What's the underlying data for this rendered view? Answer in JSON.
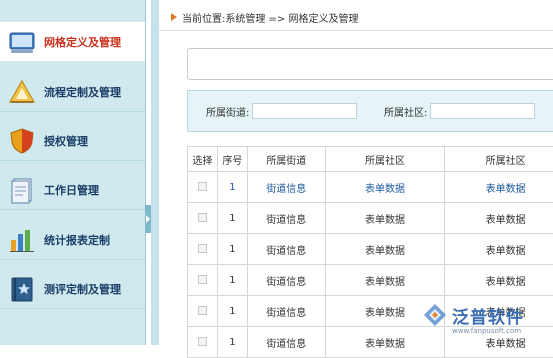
{
  "sidebar": {
    "items": [
      {
        "label": "网格定义及管理",
        "icon": "monitor-icon",
        "active": true
      },
      {
        "label": "流程定制及管理",
        "icon": "triangle-ruler-icon",
        "active": false
      },
      {
        "label": "授权管理",
        "icon": "shield-icon",
        "active": false
      },
      {
        "label": "工作日管理",
        "icon": "document-icon",
        "active": false
      },
      {
        "label": "统计报表定制",
        "icon": "bar-chart-icon",
        "active": false
      },
      {
        "label": "测评定制及管理",
        "icon": "star-book-icon",
        "active": false
      }
    ]
  },
  "breadcrumb": {
    "text": "当前位置:系统管理 => 网格定义及管理"
  },
  "filters": {
    "street_label": "所属街道:",
    "community_label": "所属社区:"
  },
  "table": {
    "headers": [
      "选择",
      "序号",
      "所属街道",
      "所属社区",
      "所属社区"
    ],
    "rows": [
      {
        "index": "1",
        "street": "街道信息",
        "community": "表单数据",
        "community2": "表单数据",
        "link": true
      },
      {
        "index": "1",
        "street": "街道信息",
        "community": "表单数据",
        "community2": "表单数据",
        "link": false
      },
      {
        "index": "1",
        "street": "街道信息",
        "community": "表单数据",
        "community2": "表单数据",
        "link": false
      },
      {
        "index": "1",
        "street": "街道信息",
        "community": "表单数据",
        "community2": "表单数据",
        "link": false
      },
      {
        "index": "1",
        "street": "街道信息",
        "community": "表单数据",
        "community2": "表单数据",
        "link": false
      },
      {
        "index": "1",
        "street": "街道信息",
        "community": "表单数据",
        "community2": "表单数据",
        "link": false
      }
    ]
  },
  "watermark": {
    "text": "泛普软件",
    "url": "www.fanpusoft.com"
  },
  "colors": {
    "active_label": "#c8321e",
    "nav_label": "#1a3c66",
    "link": "#1f5aa0",
    "sidebar_bg": "#cfe9ee"
  }
}
